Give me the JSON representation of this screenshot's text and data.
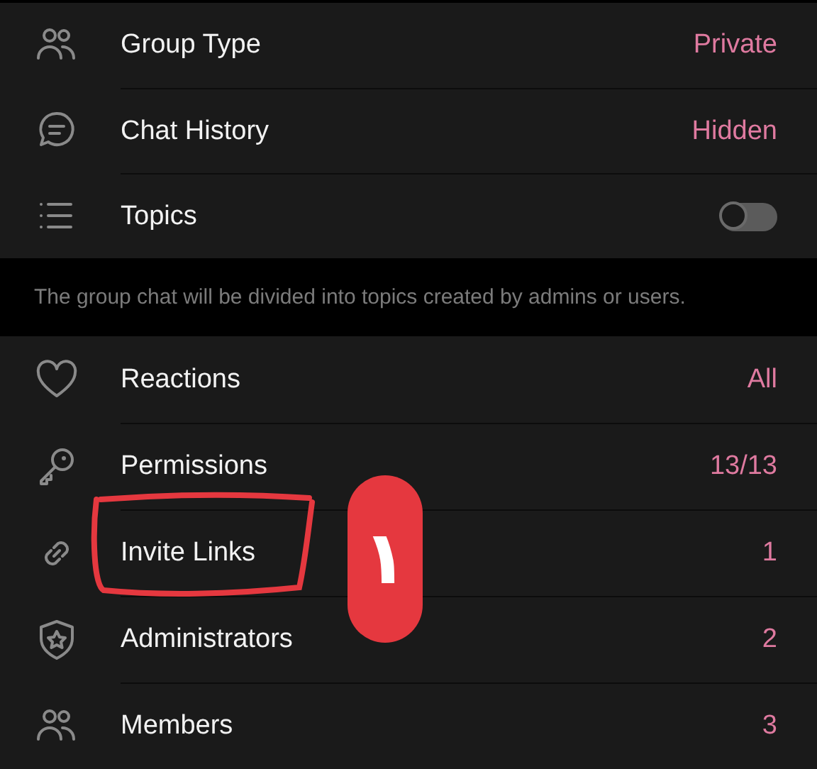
{
  "groups": [
    {
      "rows": [
        {
          "kind": "value",
          "label": "Group Type",
          "value": "Private"
        },
        {
          "kind": "value",
          "label": "Chat History",
          "value": "Hidden"
        },
        {
          "kind": "toggle",
          "label": "Topics",
          "on": false
        }
      ],
      "footer": "The group chat will be divided into topics created by admins or users."
    },
    {
      "rows": [
        {
          "kind": "value",
          "label": "Reactions",
          "value": "All"
        },
        {
          "kind": "value",
          "label": "Permissions",
          "value": "13/13"
        },
        {
          "kind": "value",
          "label": "Invite Links",
          "value": "1",
          "circled": true
        },
        {
          "kind": "value",
          "label": "Administrators",
          "value": "2"
        },
        {
          "kind": "value",
          "label": "Members",
          "value": "3"
        }
      ]
    }
  ],
  "annotation": {
    "badge": "١"
  }
}
